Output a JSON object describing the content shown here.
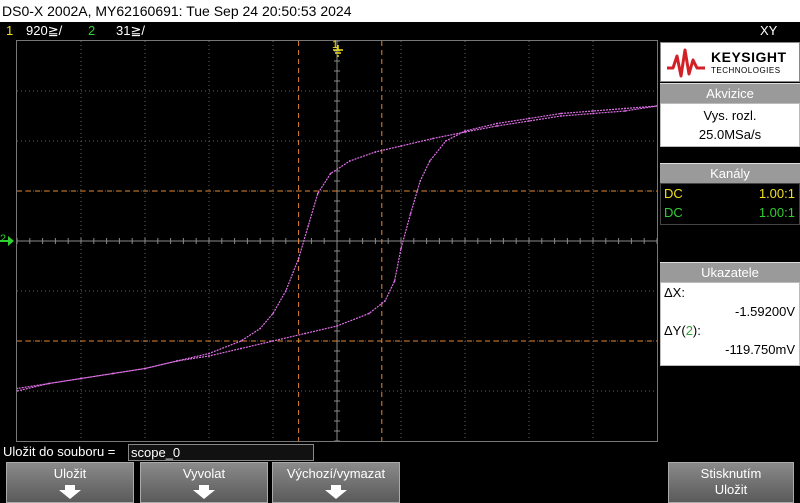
{
  "title": "DS0-X 2002A, MY62160691: Tue Sep 24 20:50:53 2024",
  "channel_bar": {
    "ch1_num": "1",
    "ch1_scale": "920≧/",
    "ch2_num": "2",
    "ch2_scale": "31≧/",
    "mode": "XY"
  },
  "markers": {
    "ch1_marker": "1",
    "ch2_marker": "2"
  },
  "logo": {
    "brand": "KEYSIGHT",
    "sub": "TECHNOLOGIES"
  },
  "acquisition": {
    "header": "Akvizice",
    "mode": "Vys. rozl.",
    "rate": "25.0MSa/s"
  },
  "channels": {
    "header": "Kanály",
    "rows": [
      {
        "coupling": "DC",
        "probe": "1.00:1",
        "color": "#f0e020"
      },
      {
        "coupling": "DC",
        "probe": "1.00:1",
        "color": "#30d030"
      }
    ]
  },
  "cursors": {
    "header": "Ukazatele",
    "dx_label": "ΔX:",
    "dx_value": "-1.59200V",
    "dy_label_pre": "ΔY(",
    "dy_label_ch": "2",
    "dy_label_post": "):",
    "dy_value": "-119.750mV"
  },
  "file": {
    "label": "Uložit do souboru =",
    "value": "scope_0"
  },
  "softkeys": {
    "save": "Uložit",
    "recall": "Vyvolat",
    "default_erase": "Výchozí/vymazat",
    "press_line1": "Stisknutím",
    "press_line2": "Uložit"
  },
  "colors": {
    "trace": "#e070e8",
    "cursor": "#e08838",
    "grid": "#606060",
    "ch1": "#f0e020",
    "ch2": "#30d030"
  },
  "chart_data": {
    "type": "scatter",
    "mode": "XY",
    "grid": "on",
    "grid_divisions": {
      "x": 10,
      "y": 8
    },
    "x_units": "divisions",
    "y_units": "divisions",
    "x_range": [
      -5,
      5
    ],
    "y_range": [
      -4,
      4
    ],
    "series": [
      {
        "points": [
          [
            -5.0,
            -3.0
          ],
          [
            -4.5,
            -2.85
          ],
          [
            -4.0,
            -2.75
          ],
          [
            -3.5,
            -2.65
          ],
          [
            -3.0,
            -2.55
          ],
          [
            -2.5,
            -2.4
          ],
          [
            -2.0,
            -2.25
          ],
          [
            -1.5,
            -2.0
          ],
          [
            -1.2,
            -1.75
          ],
          [
            -1.0,
            -1.45
          ],
          [
            -0.8,
            -1.0
          ],
          [
            -0.6,
            -0.35
          ],
          [
            -0.45,
            0.3
          ],
          [
            -0.3,
            0.95
          ],
          [
            -0.1,
            1.35
          ],
          [
            0.2,
            1.6
          ],
          [
            0.6,
            1.78
          ],
          [
            1.0,
            1.9
          ],
          [
            1.5,
            2.05
          ],
          [
            2.0,
            2.18
          ],
          [
            2.5,
            2.3
          ],
          [
            3.0,
            2.4
          ],
          [
            3.5,
            2.5
          ],
          [
            4.0,
            2.55
          ],
          [
            4.5,
            2.6
          ],
          [
            5.0,
            2.7
          ],
          [
            4.5,
            2.65
          ],
          [
            4.0,
            2.6
          ],
          [
            3.5,
            2.55
          ],
          [
            3.0,
            2.45
          ],
          [
            2.5,
            2.35
          ],
          [
            2.0,
            2.2
          ],
          [
            1.7,
            2.0
          ],
          [
            1.45,
            1.6
          ],
          [
            1.3,
            1.2
          ],
          [
            1.15,
            0.55
          ],
          [
            1.0,
            -0.15
          ],
          [
            0.9,
            -0.8
          ],
          [
            0.75,
            -1.2
          ],
          [
            0.5,
            -1.45
          ],
          [
            0.0,
            -1.7
          ],
          [
            -0.5,
            -1.85
          ],
          [
            -1.0,
            -2.0
          ],
          [
            -1.5,
            -2.15
          ],
          [
            -2.0,
            -2.3
          ],
          [
            -2.5,
            -2.4
          ],
          [
            -3.0,
            -2.55
          ],
          [
            -3.5,
            -2.65
          ],
          [
            -4.0,
            -2.75
          ],
          [
            -4.5,
            -2.85
          ],
          [
            -5.0,
            -2.95
          ]
        ]
      }
    ],
    "cursors": {
      "x1": -0.6,
      "x2": 0.7,
      "y1": 1.0,
      "y2": -2.0
    }
  }
}
